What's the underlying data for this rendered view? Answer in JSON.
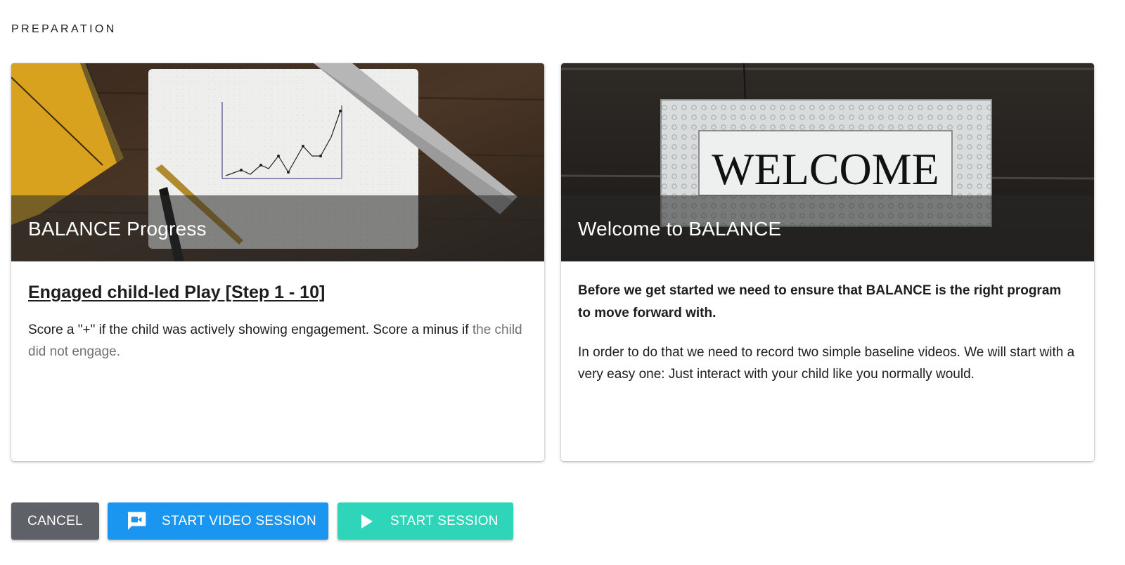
{
  "page": {
    "section_label": "PREPARATION"
  },
  "cards": [
    {
      "media_title": "BALANCE Progress",
      "heading": "Engaged child-led Play [Step 1 - 10]",
      "text_main": "Score a \"+\" if the child was actively showing engagement. Score a minus if",
      "text_faded": "the child did not engage."
    },
    {
      "media_title": "Welcome to BALANCE",
      "sign_text": "WELCOME",
      "intro_bold": "Before we get started we need to ensure that BALANCE is the right program to move forward with.",
      "paragraph": "In order to do that we need to record two simple baseline videos. We will start with a very easy one: Just interact with your child like you normally would."
    }
  ],
  "buttons": {
    "cancel": "CANCEL",
    "start_video_session": "START VIDEO SESSION",
    "start_session": "START SESSION"
  },
  "colors": {
    "cancel_bg": "#5f6168",
    "video_bg": "#1a95f0",
    "start_bg": "#2ed5b8"
  },
  "icons": {
    "video_button_icon": "video-chat-icon",
    "start_button_icon": "play-icon"
  }
}
